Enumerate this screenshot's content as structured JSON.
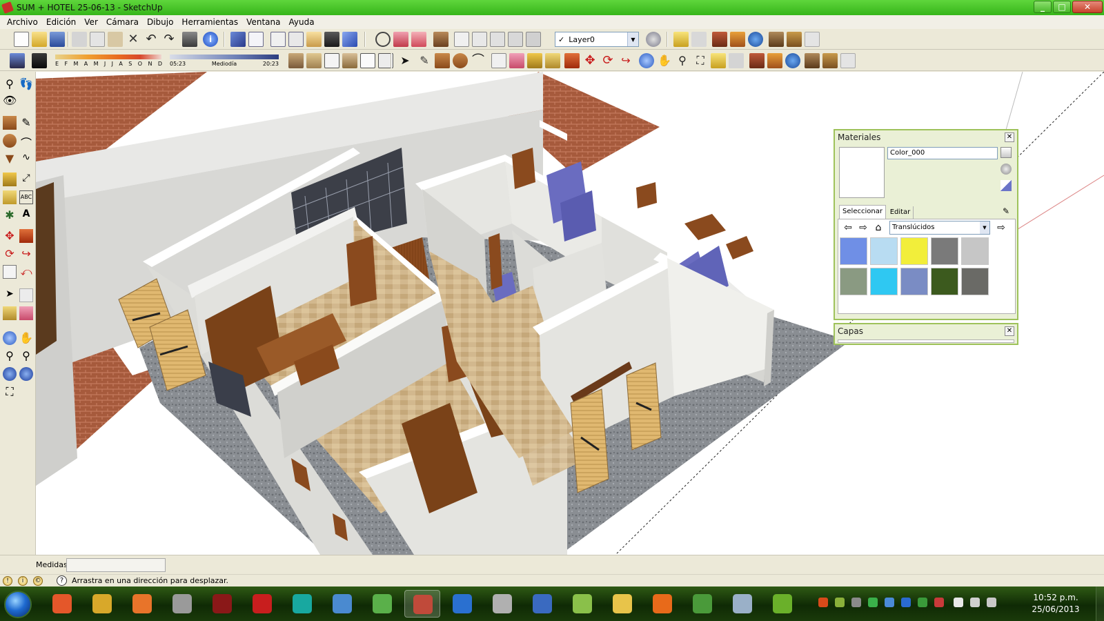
{
  "window": {
    "title": "SUM + HOTEL 25-06-13 - SketchUp",
    "controls": {
      "minimize": "_",
      "maximize": "□",
      "close": "✕"
    }
  },
  "menu": [
    "Archivo",
    "Edición",
    "Ver",
    "Cámara",
    "Dibujo",
    "Herramientas",
    "Ventana",
    "Ayuda"
  ],
  "toolbar": {
    "layer_select": "Layer0",
    "layer_check": "✓",
    "dropdown_arrow": "▼",
    "shadow_months": [
      "E",
      "F",
      "M",
      "A",
      "M",
      "J",
      "J",
      "A",
      "S",
      "O",
      "N",
      "D"
    ],
    "shadow_time": {
      "start": "05:23",
      "mid": "Mediodía",
      "end": "20:23"
    }
  },
  "materials_panel": {
    "title": "Materiales",
    "close": "✕",
    "material_name": "Color_000",
    "tabs": {
      "select": "Seleccionar",
      "edit": "Editar"
    },
    "collection": "Translúcidos",
    "nav": {
      "back": "⇦",
      "forward": "⇨",
      "home": "⌂",
      "details": "⇨"
    },
    "swatch_colors": [
      "#6f8fe6",
      "#b8dcf2",
      "#f2ee3a",
      "#7a7a7a",
      "#c6c6c6",
      "#8a9a82",
      "#2fc8f2",
      "#7a8cc4",
      "#3c5a1e",
      "#6a6a66"
    ]
  },
  "layers_panel": {
    "title": "Capas",
    "close": "✕"
  },
  "measurements": {
    "label": "Medidas",
    "value": ""
  },
  "status": {
    "icons": [
      "!",
      "i",
      "©"
    ],
    "help": "?",
    "text": "Arrastra en una dirección para desplazar."
  },
  "taskbar": {
    "apps": [
      {
        "name": "firefox-alt",
        "color": "#e4572a",
        "active": false
      },
      {
        "name": "winamp",
        "color": "#d8a82a",
        "active": false
      },
      {
        "name": "media-player",
        "color": "#e8742a",
        "active": false
      },
      {
        "name": "pinnacle",
        "color": "#9a9a9a",
        "active": false
      },
      {
        "name": "autocad",
        "color": "#8a1818",
        "active": false
      },
      {
        "name": "acrobat",
        "color": "#c81e1e",
        "active": false
      },
      {
        "name": "app-s",
        "color": "#18a8a0",
        "active": false
      },
      {
        "name": "flight",
        "color": "#4a8ad0",
        "active": false
      },
      {
        "name": "plant",
        "color": "#5ab04a",
        "active": false
      },
      {
        "name": "sketchup",
        "color": "#c04a3a",
        "active": true
      },
      {
        "name": "earth",
        "color": "#2a70d0",
        "active": false
      },
      {
        "name": "tools",
        "color": "#b0b0b0",
        "active": false
      },
      {
        "name": "media-center",
        "color": "#3a6ac0",
        "active": false
      },
      {
        "name": "notes",
        "color": "#8ac04a",
        "active": false
      },
      {
        "name": "folder",
        "color": "#e8c44a",
        "active": false
      },
      {
        "name": "firefox",
        "color": "#e86a1a",
        "active": false
      },
      {
        "name": "chrome",
        "color": "#4a9a3a",
        "active": false
      },
      {
        "name": "paint",
        "color": "#9ab0c8",
        "active": false
      },
      {
        "name": "map-tool",
        "color": "#6ab02a",
        "active": false
      }
    ],
    "clock_time": "10:52 p.m.",
    "clock_date": "25/06/2013"
  }
}
